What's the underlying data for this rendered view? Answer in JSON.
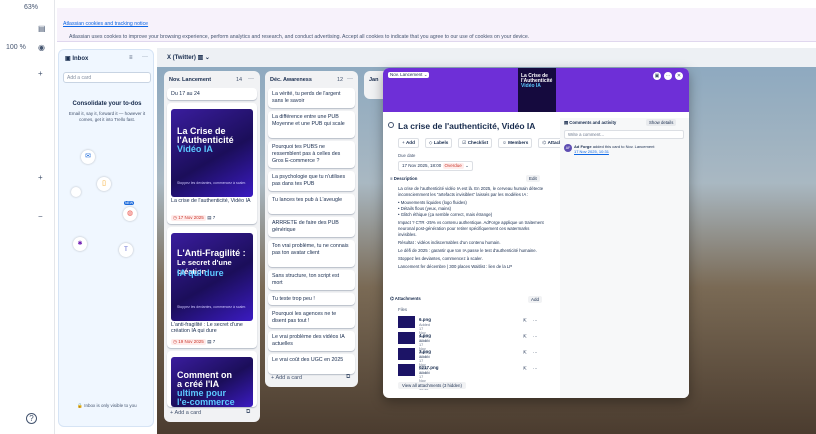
{
  "left_panel": {
    "zoom": "63%",
    "percent": "100",
    "pct_sign": "%"
  },
  "banner": {
    "text": "Atlassian uses cookies to improve your browsing experience, perform analytics and research, and conduct advertising. Accept all cookies to indicate that you agree to our use of cookies on your device.",
    "link": "Atlassian cookies and tracking notice"
  },
  "inbox": {
    "title": "Inbox",
    "add_placeholder": "Add a card",
    "heading": "Consolidate your to-dos",
    "body": "Email it, say it, forward it — however it comes, get it into Trello fast.",
    "footer": "Inbox is only visible to you",
    "new_badge": "NEW"
  },
  "board": {
    "title": "X (Twitter)"
  },
  "lists": [
    {
      "name": "Nov. Lancement",
      "count": "14",
      "first": "Du 17 au 24"
    },
    {
      "name": "Déc. Awareness",
      "count": "12"
    },
    {
      "name": "Jan"
    }
  ],
  "cards_nov": [
    {
      "cover_line1": "La Crise de",
      "cover_line2": "l'Authenticité",
      "cover_line3": "Vidéo IA",
      "cover_sub": "Stoppez les deviantes, commencez à scaler.",
      "title": "La crise de l'authenticité, Vidéo IA",
      "date": "17 Nov 2025",
      "checklist": "7"
    },
    {
      "cover_line1": "L'Anti-Fragilité :",
      "cover_line2": "Le secret d'une création",
      "cover_line3": "IA qui dure",
      "cover_sub": "Stoppez les deviantes, commencez à scaler.",
      "title": "L'anti-fragilité : Le secret d'une création IA qui dure",
      "date": "19 Nov 2025",
      "checklist": "7"
    },
    {
      "cover_line1": "Comment on",
      "cover_line2": "a créé l'IA",
      "cover_line3": "ultime pour",
      "cover_line4": "l'e-commerce"
    }
  ],
  "cards_dec": [
    "La vérité, tu perds de l'argent sans le savoir",
    "La différence entre une PUB Moyenne et une PUB qui scale",
    "Pourquoi tes PUBS ne ressemblent pas à celles des Gros E-commerce ?",
    "La psychologie que tu n'utilises pas dans tes PUB",
    "Tu lances tes pub à L'aveugle",
    "ARRRETE de faire des PUB générique",
    "Ton vrai problème, tu ne connais pas ton avatar client",
    "Sans structure, ton script est mort",
    "Tu teste trop peu !",
    "Pourquoi les agences ne te disent pas tout !",
    "Le vrai problème des vidéos IA actuelles",
    "Le vrai coût des UGC en 2025"
  ],
  "add_card": "Add a card",
  "modal": {
    "list_pill": "Nov. Lancement",
    "title": "La crise de l'authenticité, Vidéo IA",
    "actions": [
      "Add",
      "Labels",
      "Checklist",
      "Members",
      "Attachment"
    ],
    "due_label": "Due date",
    "due_value": "17 Nov 2025, 18:00",
    "due_badge": "Overdue",
    "desc_label": "Description",
    "edit": "Edit",
    "desc": [
      "La crise de l'authenticité vidéo IA est là. En 2025, le cerveau humain détecte inconsciemment les \"artefacts invisibles\" laissés par les modèles IA :",
      "Mouvements liquides (logo fluides)",
      "Détails flous (yeux, mains)",
      "Glitch éthique (ça semble correct, mais étrange)",
      "Impact ? CTR -25% vs contenu authentique. AdForge applique un traitement neuronal post-génération pour retirer spécifiquement ces watermarks invisibles.",
      "Résultat : vidéos indiscernables d'un contenu humain.",
      "Le défi de 2025 : garantir que ton IA passe le test d'authenticité humaine.",
      "Stoppez les deviantes, commencez à scaler.",
      "Lancement fer décembre | 300 places Waitlist : lien de la LP"
    ],
    "attach_label": "Attachments",
    "add": "Add",
    "files_label": "Files",
    "files": [
      {
        "name": "6.png",
        "date": "Added 17 Nov 2025, 10:42"
      },
      {
        "name": "4.png",
        "date": "Added 17 Nov 2025, 10:42"
      },
      {
        "name": "3.png",
        "date": "Added 17 Nov 2025, 10:42"
      },
      {
        "name": "0217.png",
        "date": "Added 17 Nov 2025, 10:42"
      }
    ],
    "view_all": "View all attachments (3 hidden)",
    "comments_label": "Comments and activity",
    "show_details": "Show details",
    "comment_placeholder": "Write a comment...",
    "activity_user": "Ad Forge",
    "activity_text": "added this card to Nov. Lancement",
    "activity_time": "17 Nov 2025, 10:31",
    "avatar": "AF"
  },
  "colors": {
    "accent": "#6e2fd7",
    "overdue": "#c9372c",
    "link": "#0c66e4"
  }
}
